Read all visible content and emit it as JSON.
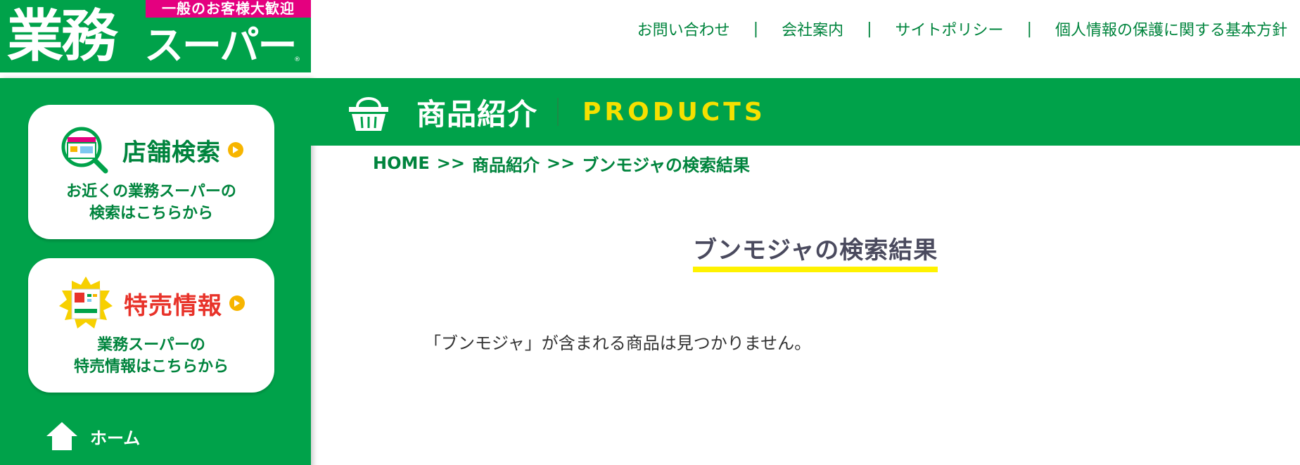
{
  "header": {
    "logo": {
      "badge": "一般のお客様大歓迎",
      "name_kanji": "業務",
      "name_kana": "スーパー",
      "registered_mark": "®"
    },
    "nav": [
      {
        "label": "お問い合わせ"
      },
      {
        "label": "会社案内"
      },
      {
        "label": "サイトポリシー"
      },
      {
        "label": "個人情報の保護に関する基本方針"
      }
    ],
    "nav_separator": "|"
  },
  "sidebar": {
    "store_search": {
      "title": "店舗検索",
      "desc_line1": "お近くの業務スーパーの",
      "desc_line2": "検索はこちらから",
      "icon": "store-search-icon"
    },
    "special_sale": {
      "title": "特売情報",
      "desc_line1": "業務スーパーの",
      "desc_line2": "特売情報はこちらから",
      "icon": "flyer-icon"
    },
    "home": {
      "label": "ホーム",
      "icon": "home-icon"
    }
  },
  "section": {
    "title_ja": "商品紹介",
    "title_en": "PRODUCTS",
    "icon": "basket-icon"
  },
  "breadcrumb": {
    "home": "HOME",
    "separator": ">>",
    "products": "商品紹介",
    "current": "ブンモジャの検索結果"
  },
  "result": {
    "title": "ブンモジャの検索結果",
    "message": "「ブンモジャ」が含まれる商品は見つかりません。"
  },
  "colors": {
    "brand_green": "#00a24a",
    "text_green": "#00843d",
    "accent_yellow": "#f6e000",
    "badge_pink": "#e4007f",
    "sale_red": "#e8332a"
  }
}
